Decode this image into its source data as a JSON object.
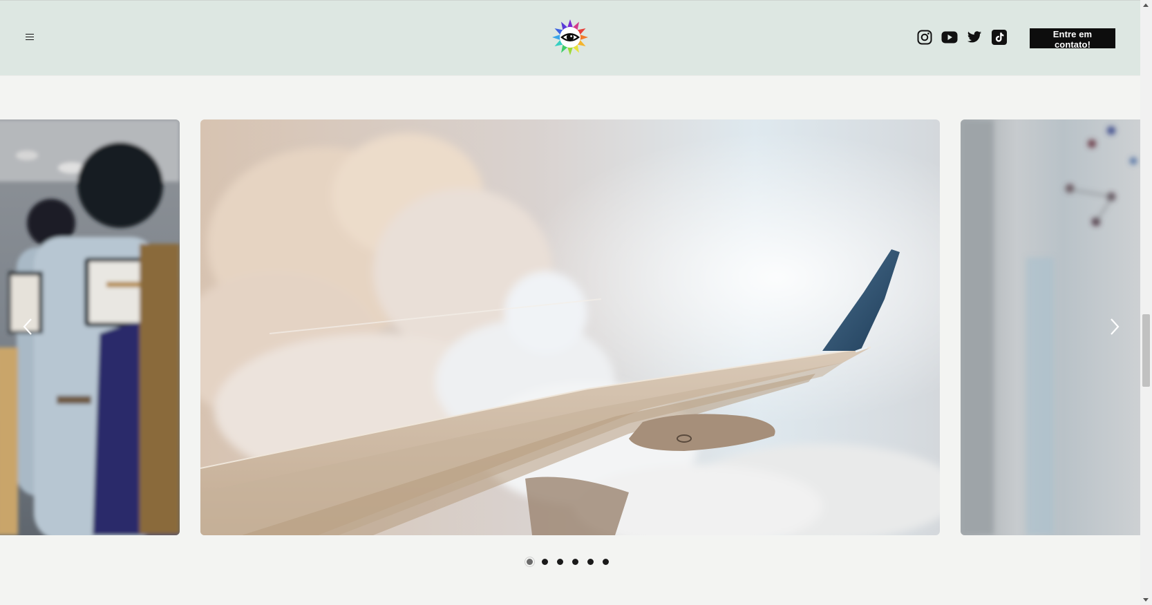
{
  "header": {
    "menu_icon": "hamburger-menu-icon",
    "logo_icon": "rainbow-eye-logo",
    "social": [
      {
        "name": "instagram",
        "icon": "instagram-icon"
      },
      {
        "name": "youtube",
        "icon": "youtube-icon"
      },
      {
        "name": "twitter",
        "icon": "twitter-icon"
      },
      {
        "name": "tiktok",
        "icon": "tiktok-icon"
      }
    ],
    "cta_label": "Entre em contato!"
  },
  "carousel": {
    "slides": [
      {
        "description_icon": "airplane-cabin-photo",
        "state": "previous"
      },
      {
        "description_icon": "airplane-wing-clouds-photo",
        "state": "current"
      },
      {
        "description_icon": "blurred-window-photo",
        "state": "next"
      }
    ],
    "prev_icon": "chevron-left-icon",
    "next_icon": "chevron-right-icon",
    "dot_count": 6,
    "active_dot": 0
  },
  "colors": {
    "header_bg": "#dde7e2",
    "page_bg": "#f3f4f2",
    "cta_bg": "#0d0d0d",
    "cta_text": "#ffffff"
  }
}
